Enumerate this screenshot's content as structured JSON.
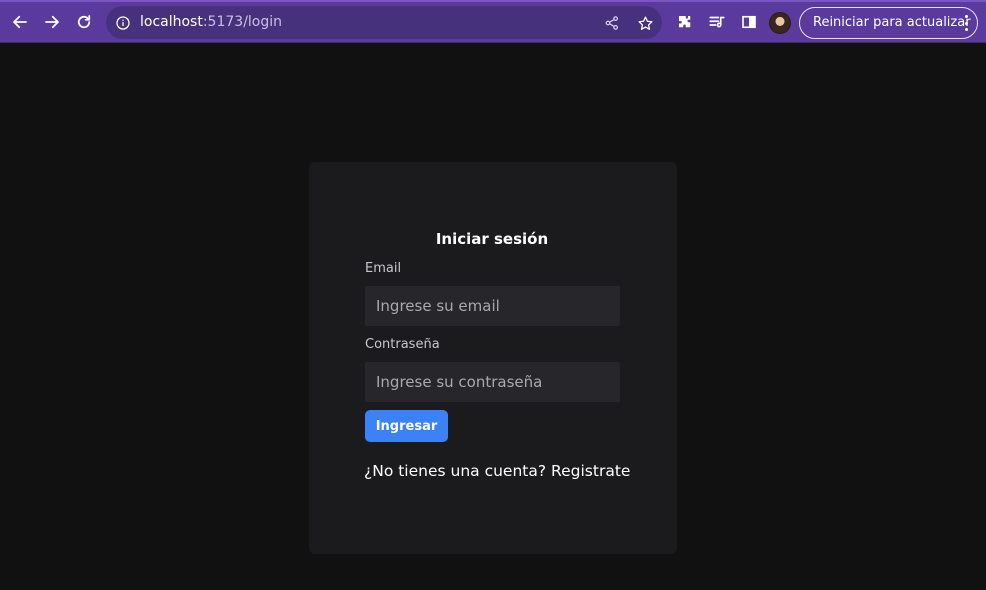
{
  "browser": {
    "url_host": "localhost",
    "url_rest": ":5173/login",
    "update_button_label": "Reiniciar para actualizar",
    "icons": [
      "back-icon",
      "forward-icon",
      "reload-icon",
      "info-icon",
      "share-icon",
      "star-icon",
      "extensions-icon",
      "reading-list-icon",
      "side-panel-icon",
      "profile-avatar",
      "menu-dots-icon"
    ],
    "accent_color": "#5b3a9e"
  },
  "login": {
    "title": "Iniciar sesión",
    "email_label": "Email",
    "email_placeholder": "Ingrese su email",
    "password_label": "Contraseña",
    "password_placeholder": "Ingrese su contraseña",
    "submit_label": "Ingresar",
    "register_prompt": "¿No tienes una cuenta?",
    "register_link": "Registrate",
    "button_color": "#3b82f6"
  }
}
